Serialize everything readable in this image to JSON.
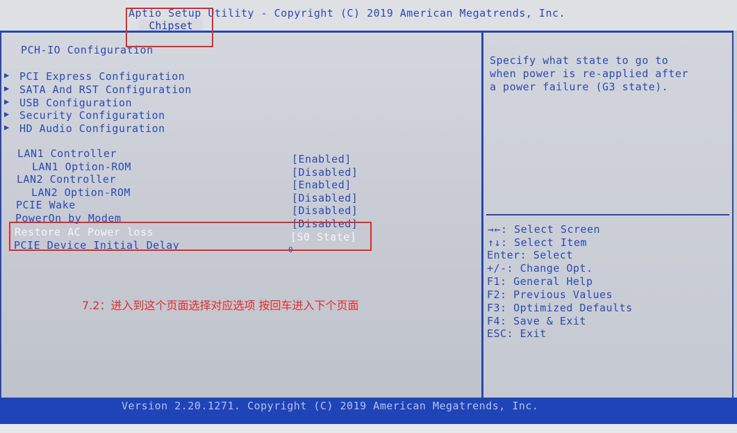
{
  "header": {
    "title": "Aptio Setup Utility - Copyright (C) 2019 American Megatrends, Inc.",
    "active_tab": "Chipset"
  },
  "page": {
    "section_title": "PCH-IO Configuration"
  },
  "submenus": [
    {
      "label": "PCI Express Configuration"
    },
    {
      "label": "SATA And RST Configuration"
    },
    {
      "label": "USB Configuration"
    },
    {
      "label": "Security Configuration"
    },
    {
      "label": "HD Audio Configuration"
    }
  ],
  "settings": [
    {
      "label": "LAN1 Controller",
      "value": "[Enabled]"
    },
    {
      "label": "LAN1 Option-ROM",
      "value": "[Disabled]"
    },
    {
      "label": "LAN2 Controller",
      "value": "[Enabled]"
    },
    {
      "label": "LAN2 Option-ROM",
      "value": "[Disabled]"
    },
    {
      "label": "PCIE Wake",
      "value": "[Disabled]"
    },
    {
      "label": "PowerOn by Modem",
      "value": "[Disabled]"
    },
    {
      "label": "Restore AC Power loss",
      "value": "[S0 State]"
    },
    {
      "label": "PCIE Device Initial Delay",
      "value": "0"
    }
  ],
  "help": {
    "description": [
      "Specify what state to go to",
      "when power is re-applied after",
      "a power failure (G3 state)."
    ]
  },
  "keys": [
    "→←: Select Screen",
    "↑↓: Select Item",
    "Enter: Select",
    "+/-: Change Opt.",
    "F1: General Help",
    "F2: Previous Values",
    "F3: Optimized Defaults",
    "F4: Save & Exit",
    "ESC: Exit"
  ],
  "footer": {
    "version": "Version 2.20.1271. Copyright (C) 2019 American Megatrends, Inc."
  },
  "annotation": {
    "text": "7.2：进入到这个页面选择对应选项 按回车进入下个页面",
    "color": "#e22b2b"
  },
  "colors": {
    "bios_blue": "#2a4ab3",
    "frame_blue": "#2648b0",
    "highlight_white": "#f4f5f8",
    "annotation_red": "#e22b2b"
  }
}
